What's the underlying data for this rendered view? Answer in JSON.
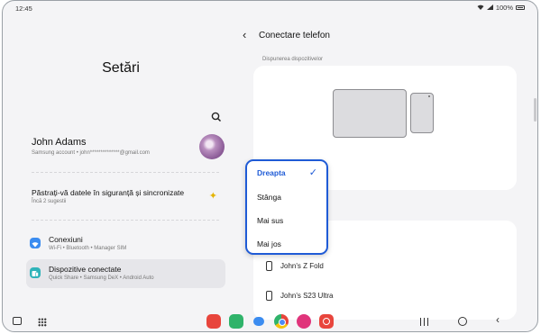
{
  "status_bar": {
    "time": "12:45",
    "battery": "100%"
  },
  "left": {
    "title": "Setări",
    "profile": {
      "name": "John Adams",
      "subtitle": "Samsung account  •  john**************@gmail.com"
    },
    "backup": {
      "title": "Păstrați-vă datele în siguranță și sincronizate",
      "subtitle": "Încă 2 sugestii"
    },
    "items": [
      {
        "title": "Conexiuni",
        "subtitle": "Wi-Fi  •  Bluetooth  •  Manager SIM"
      },
      {
        "title": "Dispozitive conectate",
        "subtitle": "Quick Share  •  Samsung DeX  •  Android Auto"
      }
    ]
  },
  "right": {
    "title": "Conectare telefon",
    "section_label": "Dispunerea dispozitivelor",
    "devices": [
      "John's Z Fold",
      "John's S23 Ultra"
    ]
  },
  "dropdown": {
    "options": [
      "Dreapta",
      "Stânga",
      "Mai sus",
      "Mai jos"
    ],
    "selected": "Dreapta"
  },
  "colors": {
    "accent": "#1f5bd6"
  },
  "icons": [
    "search-icon",
    "back-arrow-icon",
    "sparkle-icon",
    "wifi-icon",
    "connected-devices-icon",
    "phone-icon",
    "check-icon",
    "taskbar-toggle-icon",
    "apps-grid-icon",
    "recents-icon",
    "home-icon",
    "nav-back-icon"
  ]
}
